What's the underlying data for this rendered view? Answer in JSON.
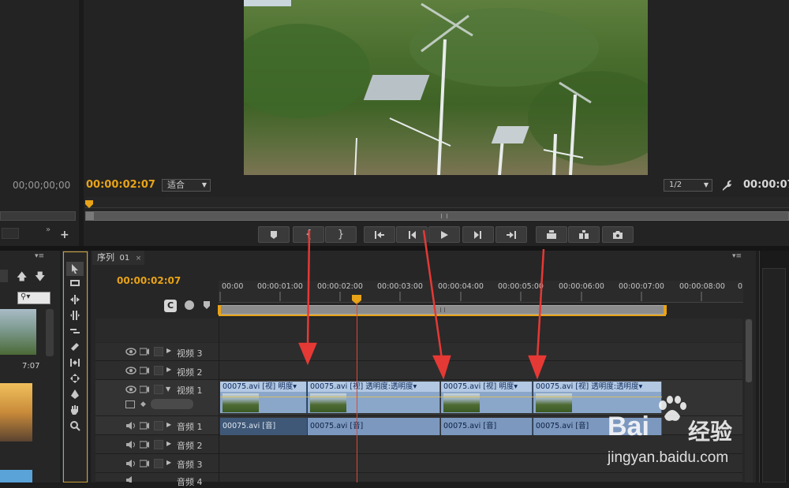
{
  "source_monitor": {
    "timecode": "00;00;00;00"
  },
  "program_monitor": {
    "timecode": "00:00:02:07",
    "fit": "适合",
    "resolution": "1/2",
    "timecode_right": "00:00:07"
  },
  "transport": [
    {
      "name": "add-marker-button",
      "glyph": "marker"
    },
    {
      "name": "mark-in-button",
      "glyph": "{"
    },
    {
      "name": "mark-out-button",
      "glyph": "}"
    },
    {
      "name": "go-to-in-button",
      "glyph": "goin"
    },
    {
      "name": "step-back-button",
      "glyph": "stepback"
    },
    {
      "name": "play-button",
      "glyph": "play"
    },
    {
      "name": "step-forward-button",
      "glyph": "stepfwd"
    },
    {
      "name": "go-to-out-button",
      "glyph": "goout"
    },
    {
      "name": "lift-button",
      "glyph": "lift"
    },
    {
      "name": "extract-button",
      "glyph": "extract"
    },
    {
      "name": "export-frame-button",
      "glyph": "camera"
    }
  ],
  "project_panel": {
    "clip_duration": "7:07"
  },
  "sequence": {
    "tab_label": "序列",
    "tab_number": "01",
    "timecode": "00:00:02:07",
    "ruler": [
      "00:00",
      "00:00:01:00",
      "00:00:02:00",
      "00:00:03:00",
      "00:00:04:00",
      "00:00:05:00",
      "00:00:06:00",
      "00:00:07:00",
      "00:00:08:00",
      "0"
    ],
    "tracks": {
      "v3": "视频 3",
      "v2": "视频 2",
      "v1": "视频 1",
      "a1": "音频 1",
      "a2": "音频 2",
      "a3": "音频 3",
      "a4": "音频 4"
    },
    "video_clips": [
      {
        "label": "00075.avi [视] 明度▾"
      },
      {
        "label": "00075.avi [视] 透明度:透明度▾"
      },
      {
        "label": "00075.avi [视] 明度▾"
      },
      {
        "label": "00075.avi [视] 透明度:透明度▾"
      }
    ],
    "audio_clips": [
      {
        "label": "00075.avi [音]"
      },
      {
        "label": "00075.avi [音]"
      },
      {
        "label": "00075.avi [音]"
      },
      {
        "label": "00075.avi [音]"
      }
    ]
  },
  "watermark": {
    "brand": "Bai",
    "brand2": "经验",
    "url": "jingyan.baidu.com"
  },
  "colors": {
    "accent": "#e8a317",
    "clip_video": "#8aa6c9",
    "clip_audio": "#7c98bf",
    "arrow": "#e53935"
  }
}
